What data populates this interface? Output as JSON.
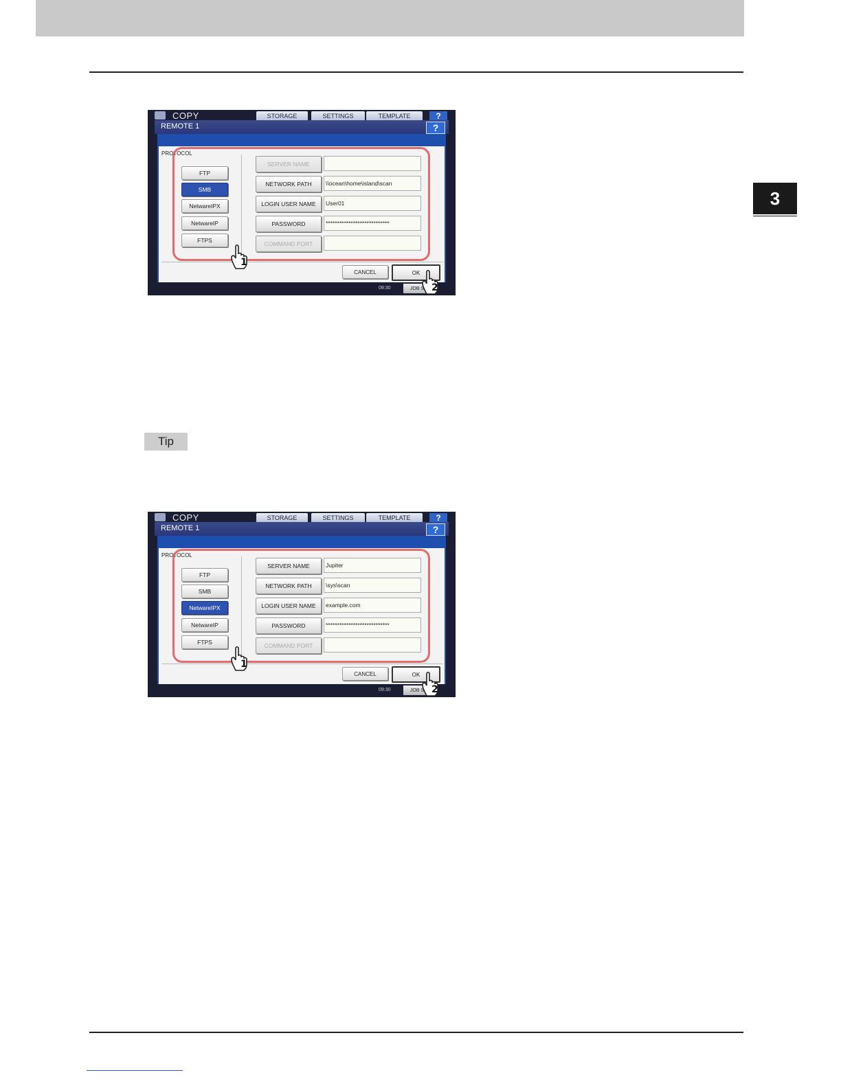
{
  "page": {
    "chapter_number": "3",
    "tip_label": "Tip"
  },
  "screens": [
    {
      "app": "COPY",
      "tabs": [
        "STORAGE",
        "SETTINGS",
        "TEMPLATE"
      ],
      "help": "?",
      "title": "REMOTE 1",
      "protocol_label": "PROTOCOL",
      "protocols": [
        "FTP",
        "SMB",
        "NetwareIPX",
        "NetwareIP",
        "FTPS"
      ],
      "selected_protocol": "SMB",
      "fields": [
        {
          "label": "SERVER NAME",
          "value": "",
          "enabled": false
        },
        {
          "label": "NETWORK PATH",
          "value": "\\\\ocean\\home\\island\\scan",
          "enabled": true
        },
        {
          "label": "LOGIN USER NAME",
          "value": "User01",
          "enabled": true
        },
        {
          "label": "PASSWORD",
          "value": "****************************",
          "enabled": true
        },
        {
          "label": "COMMAND PORT",
          "value": "",
          "enabled": false
        }
      ],
      "cancel": "CANCEL",
      "ok": "OK",
      "clock": "09:30",
      "jobs": "JOB S",
      "callouts": [
        "1",
        "2"
      ]
    },
    {
      "app": "COPY",
      "tabs": [
        "STORAGE",
        "SETTINGS",
        "TEMPLATE"
      ],
      "help": "?",
      "title": "REMOTE 1",
      "protocol_label": "PROTOCOL",
      "protocols": [
        "FTP",
        "SMB",
        "NetwareIPX",
        "NetwareIP",
        "FTPS"
      ],
      "selected_protocol": "NetwareIPX",
      "fields": [
        {
          "label": "SERVER NAME",
          "value": "Jupiter",
          "enabled": true
        },
        {
          "label": "NETWORK PATH",
          "value": "\\sys\\scan",
          "enabled": true
        },
        {
          "label": "LOGIN USER NAME",
          "value": "example.com",
          "enabled": true
        },
        {
          "label": "PASSWORD",
          "value": "****************************",
          "enabled": true
        },
        {
          "label": "COMMAND PORT",
          "value": "",
          "enabled": false
        }
      ],
      "cancel": "CANCEL",
      "ok": "OK",
      "clock": "09:30",
      "jobs": "JOB S",
      "callouts": [
        "1",
        "2"
      ]
    }
  ]
}
